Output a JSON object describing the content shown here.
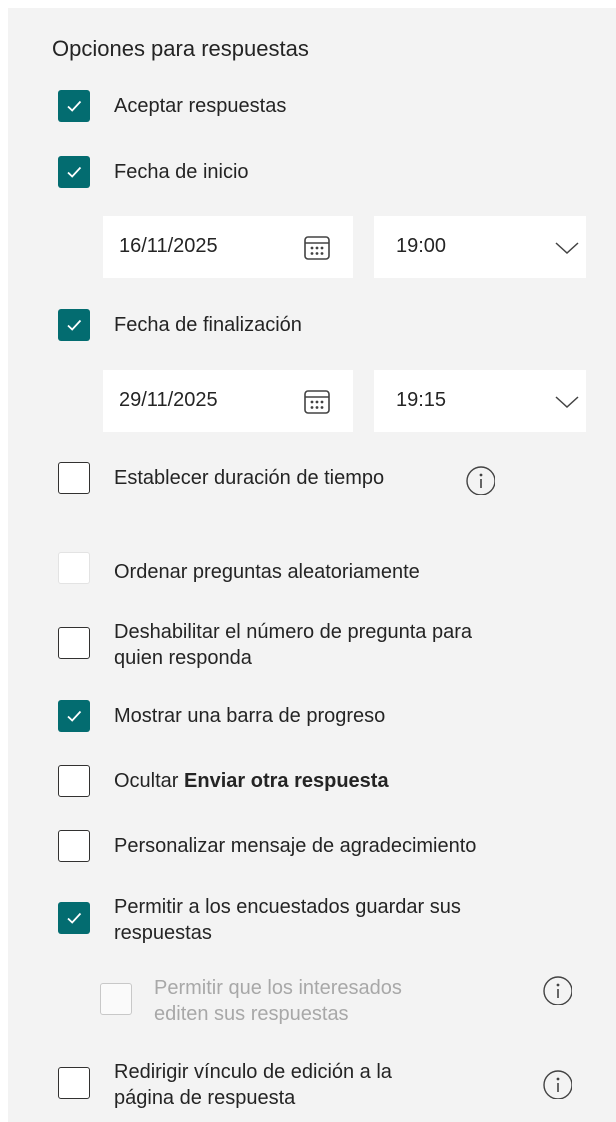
{
  "title": "Opciones para respuestas",
  "options": {
    "accept": {
      "label": "Aceptar respuestas",
      "checked": true
    },
    "start_date": {
      "label": "Fecha de inicio",
      "checked": true,
      "date": "16/11/2025",
      "time": "19:00"
    },
    "end_date": {
      "label": "Fecha de finalización",
      "checked": true,
      "date": "29/11/2025",
      "time": "19:15"
    },
    "duration": {
      "label": "Establecer duración de tiempo",
      "checked": false
    },
    "shuffle": {
      "label": "Ordenar preguntas aleatoriamente",
      "checked": false
    },
    "disable_number": {
      "label_line1": "Deshabilitar el número de pregunta para",
      "label_line2": "quien responda",
      "checked": false
    },
    "progress_bar": {
      "label": "Mostrar una barra de progreso",
      "checked": true
    },
    "hide_submit_another": {
      "label_prefix": "Ocultar",
      "label_bold": "Enviar otra respuesta",
      "checked": false
    },
    "custom_thanks": {
      "label": "Personalizar mensaje de agradecimiento",
      "checked": false
    },
    "save_responses": {
      "label_line1": "Permitir a los encuestados guardar sus",
      "label_line2": "respuestas",
      "checked": true
    },
    "edit_responses": {
      "label_line1": "Permitir que los interesados",
      "label_line2": "editen sus respuestas",
      "checked": false,
      "disabled": true
    },
    "redirect_edit_link": {
      "label_line1": "Redirigir vínculo de edición a la",
      "label_line2": "página de respuesta",
      "checked": false
    }
  },
  "icons": {
    "check": "checkmark-icon",
    "calendar": "calendar-icon",
    "chevron": "chevron-down-icon",
    "info": "info-icon"
  },
  "colors": {
    "accent": "#036c70",
    "panel": "#f3f3f3"
  }
}
